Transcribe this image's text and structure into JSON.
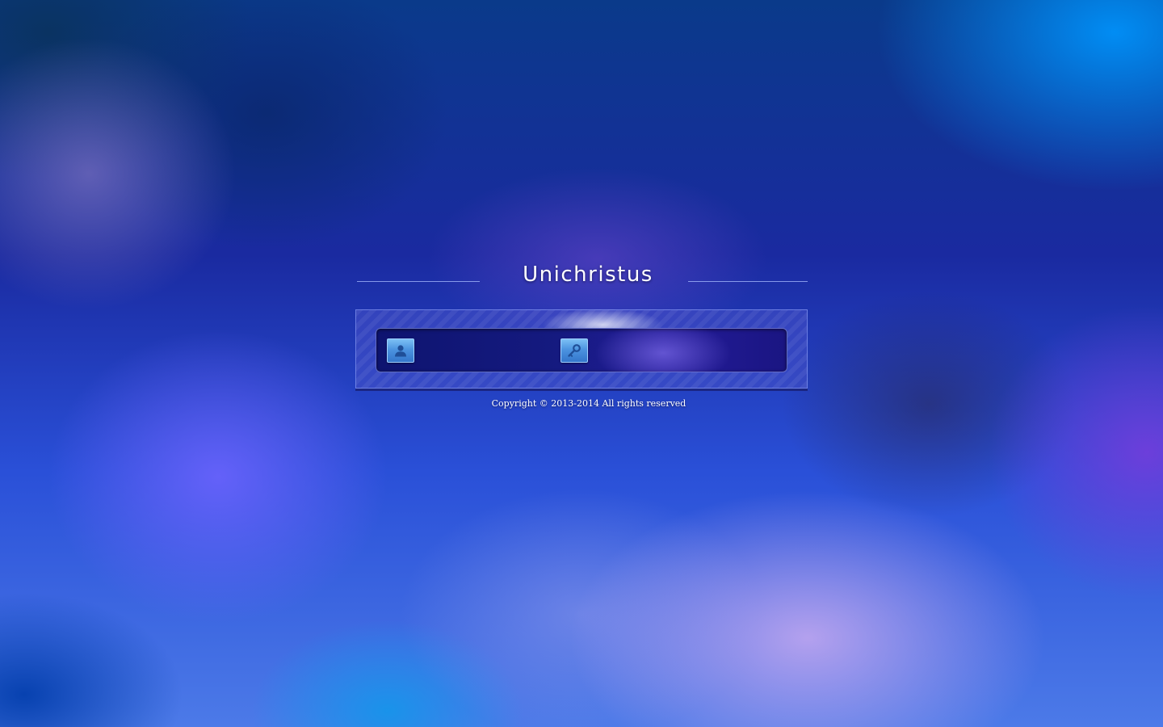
{
  "app": {
    "title": "Unichristus"
  },
  "login": {
    "username": {
      "icon": "user-icon",
      "value": "",
      "placeholder": ""
    },
    "password": {
      "icon": "key-icon",
      "value": "",
      "placeholder": ""
    }
  },
  "footer": {
    "copyright": "Copyright © 2013-2014 All rights reserved"
  },
  "colors": {
    "panel_bar": "#151a80",
    "icon_tile": "#4c94e0",
    "title_text": "#ffffff"
  }
}
